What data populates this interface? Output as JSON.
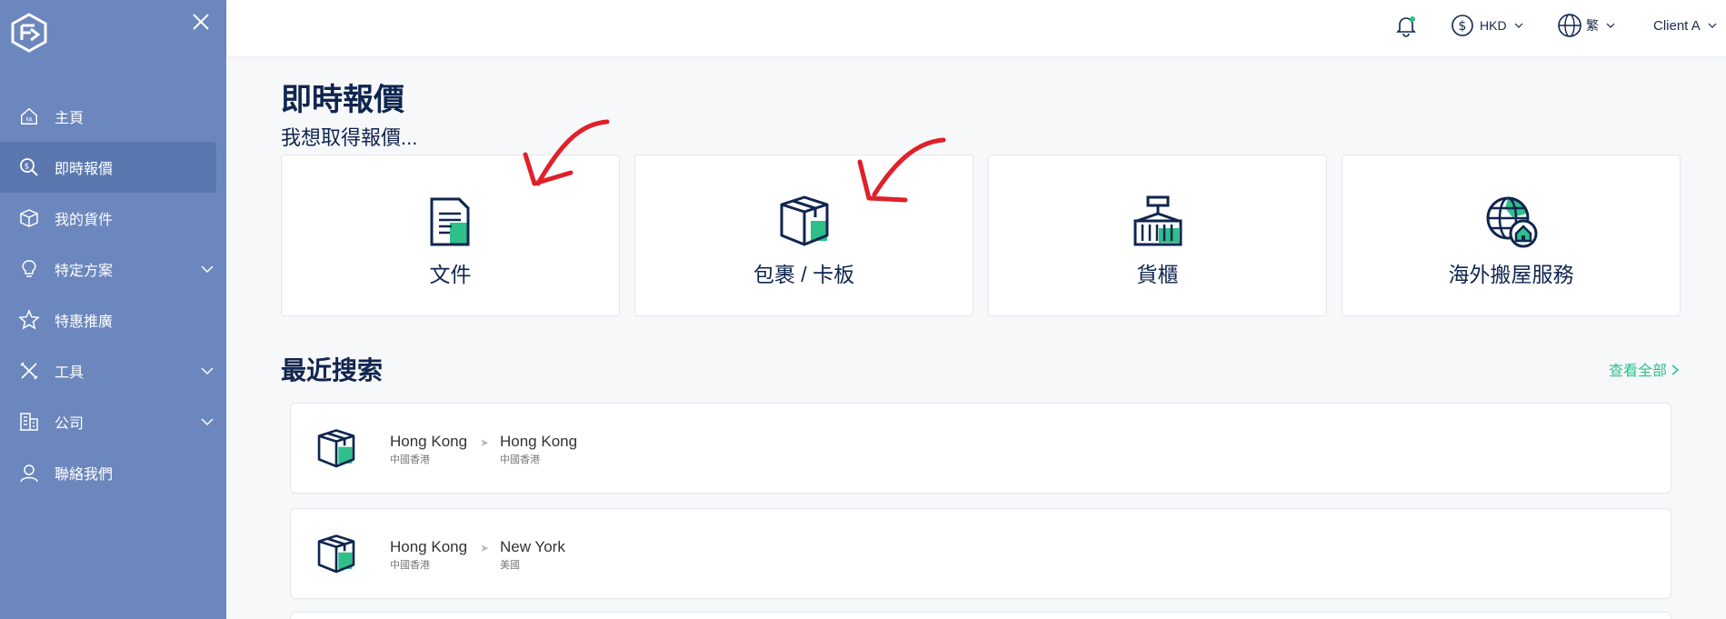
{
  "sidebar": {
    "items": [
      {
        "label": "主頁",
        "icon": "home-icon"
      },
      {
        "label": "即時報價",
        "icon": "quote-search-icon"
      },
      {
        "label": "我的貨件",
        "icon": "box-icon"
      },
      {
        "label": "特定方案",
        "icon": "lightbulb-icon"
      },
      {
        "label": "特惠推廣",
        "icon": "star-icon"
      },
      {
        "label": "工具",
        "icon": "tools-icon"
      },
      {
        "label": "公司",
        "icon": "building-icon"
      },
      {
        "label": "聯絡我們",
        "icon": "contact-icon"
      }
    ]
  },
  "header": {
    "currency": "HKD",
    "language": "繁",
    "user": "Client A"
  },
  "main": {
    "title": "即時報價",
    "subtitle": "我想取得報價...",
    "cards": [
      {
        "label": "文件",
        "icon": "document-icon"
      },
      {
        "label": "包裹 / 卡板",
        "icon": "package-icon"
      },
      {
        "label": "貨櫃",
        "icon": "container-icon"
      },
      {
        "label": "海外搬屋服務",
        "icon": "globe-house-icon"
      }
    ],
    "recent_title": "最近搜索",
    "view_all": "查看全部",
    "recent": [
      {
        "from_city": "Hong Kong",
        "from_sub": "中國香港",
        "to_city": "Hong Kong",
        "to_sub": "中國香港"
      },
      {
        "from_city": "Hong Kong",
        "from_sub": "中國香港",
        "to_city": "New York",
        "to_sub": "美國"
      }
    ],
    "route_separator": "➤"
  },
  "colors": {
    "sidebar": "#6b87bd",
    "navy": "#10254f",
    "accent_green": "#2fbf8a",
    "annotation_red": "#e0202a"
  }
}
